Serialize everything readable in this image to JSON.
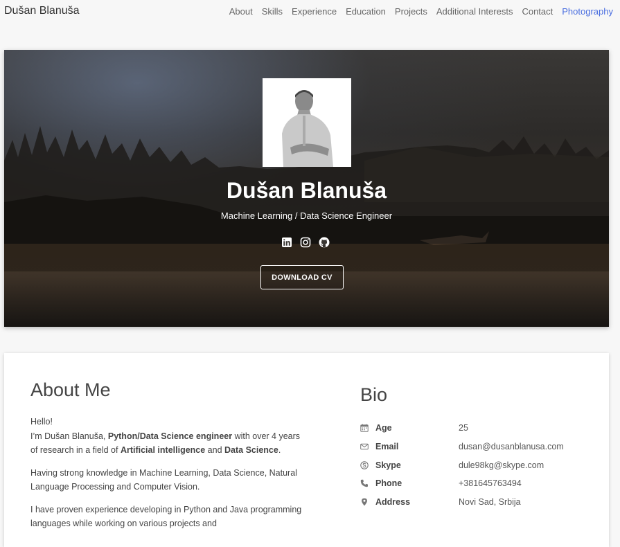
{
  "navbar": {
    "brand": "Dušan Blanuša",
    "links": [
      {
        "label": "About",
        "active": false
      },
      {
        "label": "Skills",
        "active": false
      },
      {
        "label": "Experience",
        "active": false
      },
      {
        "label": "Education",
        "active": false
      },
      {
        "label": "Projects",
        "active": false
      },
      {
        "label": "Additional Interests",
        "active": false
      },
      {
        "label": "Contact",
        "active": false
      },
      {
        "label": "Photography",
        "active": true
      }
    ]
  },
  "hero": {
    "name": "Dušan Blanuša",
    "title": "Machine Learning / Data Science Engineer",
    "socials": [
      "linkedin-icon",
      "instagram-icon",
      "github-icon"
    ],
    "cv_button": "DOWNLOAD CV"
  },
  "about": {
    "heading": "About Me",
    "greeting": "Hello!",
    "intro_a": "I’m Dušan Blanuša, ",
    "intro_b": "Python/Data Science engineer",
    "intro_c": " with over 4 years of research in a field of ",
    "intro_d": "Artificial intelligence",
    "intro_e": " and ",
    "intro_f": "Data Science",
    "intro_g": ".",
    "para2": "Having strong knowledge in Machine Learning, Data Science, Natural Language Processing and Computer Vision.",
    "para3": "I have proven experience developing in Python and Java programming languages while working on various projects and"
  },
  "bio": {
    "heading": "Bio",
    "rows": [
      {
        "icon": "calendar-icon",
        "label": "Age",
        "value": "25"
      },
      {
        "icon": "envelope-icon",
        "label": "Email",
        "value": "dusan@dusanblanusa.com"
      },
      {
        "icon": "skype-icon",
        "label": "Skype",
        "value": "dule98kg@skype.com"
      },
      {
        "icon": "phone-icon",
        "label": "Phone",
        "value": "+381645763494"
      },
      {
        "icon": "map-marker-icon",
        "label": "Address",
        "value": "Novi Sad, Srbija"
      }
    ]
  },
  "colors": {
    "accent": "#4a6ee0",
    "page_bg": "#f7f7f7"
  }
}
